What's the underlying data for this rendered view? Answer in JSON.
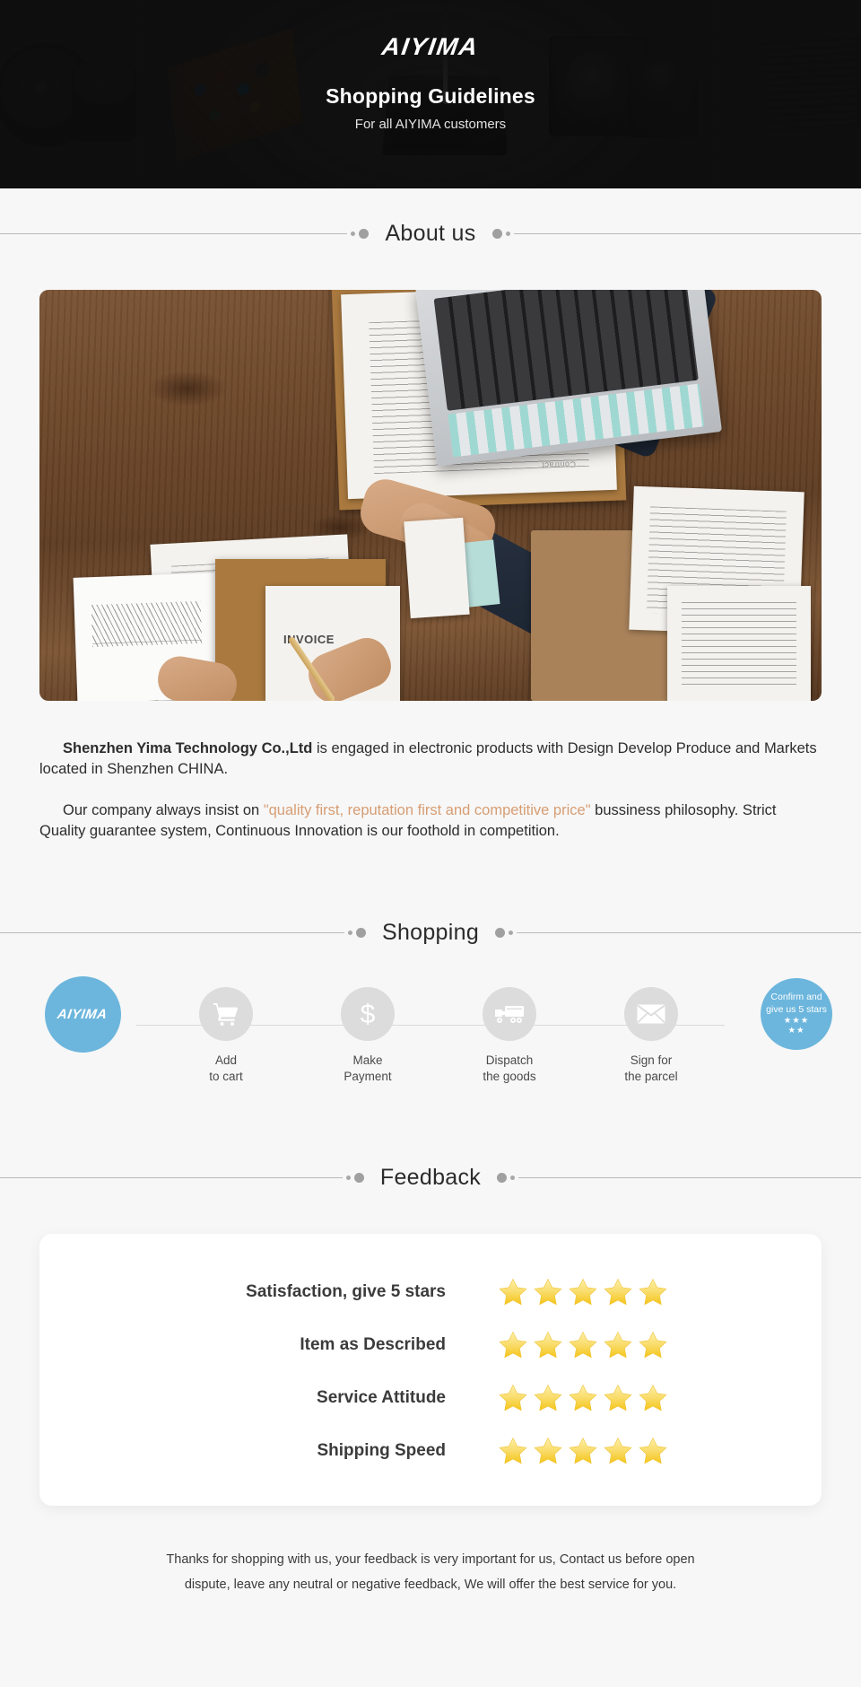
{
  "hero": {
    "logo": "AIYIMA",
    "title": "Shopping Guidelines",
    "subtitle": "For all AIYIMA customers"
  },
  "sections": {
    "about": {
      "heading": "About us"
    },
    "shopping": {
      "heading": "Shopping"
    },
    "feedback": {
      "heading": "Feedback"
    }
  },
  "about": {
    "paragraph1_company": "Shenzhen Yima Technology Co.,Ltd",
    "paragraph1_rest": " is engaged in electronic products with Design Develop Produce and Markets located in Shenzhen CHINA.",
    "paragraph2_lead": "Our company always insist on ",
    "paragraph2_quote": "\"quality first, reputation first and competitive price\"",
    "paragraph2_rest": " bussiness philosophy. Strict Quality guarantee system, Continuous Innovation is our foothold in competition.",
    "image_alt": "business-handshake-desk-photo"
  },
  "shopping": {
    "steps": [
      {
        "icon": "aiyima-logo-icon",
        "badge_text": "AIYIMA",
        "label": ""
      },
      {
        "icon": "shopping-cart-icon",
        "label": "Add\nto cart"
      },
      {
        "icon": "dollar-sign-icon",
        "label": "Make\nPayment"
      },
      {
        "icon": "delivery-truck-icon",
        "label": "Dispatch\nthe goods"
      },
      {
        "icon": "envelope-icon",
        "label": "Sign for\nthe parcel"
      },
      {
        "icon": "five-stars-icon",
        "badge_line1": "Confirm and",
        "badge_line2": "give us 5 stars",
        "stars_row1": "★★★",
        "stars_row2": "★★",
        "label": ""
      }
    ]
  },
  "feedback": {
    "rows": [
      {
        "label": "Satisfaction, give 5 stars",
        "stars": 5
      },
      {
        "label": "Item as Described",
        "stars": 5
      },
      {
        "label": "Service Attitude",
        "stars": 5
      },
      {
        "label": "Shipping Speed",
        "stars": 5
      }
    ]
  },
  "footer": {
    "line1": "Thanks for shopping with us, your feedback is very important for us, Contact us before open",
    "line2": "dispute, leave any neutral or negative feedback, We will offer the best service for you."
  },
  "colors": {
    "hero_bg": "#151515",
    "page_bg": "#f7f7f7",
    "accent_blue": "#6cb6dd",
    "accent_tan": "#d79d73",
    "bubble_gray": "#dcdcdc",
    "star_yellow": "#f9d548"
  }
}
